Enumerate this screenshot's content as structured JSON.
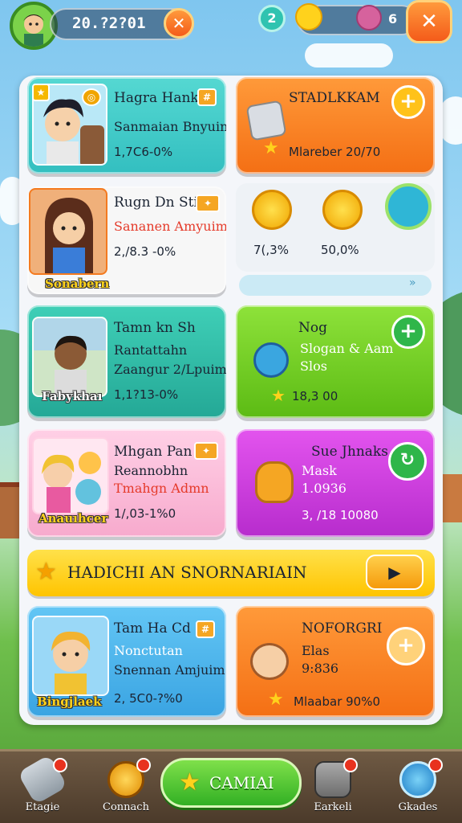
{
  "top_bar": {
    "coins": "20.?2?01",
    "gems_badge": "2",
    "counter": "6"
  },
  "cards": [
    {
      "title": "Hagra Hank",
      "subtitle": "Sanmaian Bnyuin",
      "value": "1,7C6-0%"
    },
    {
      "title": "STADLKKAM",
      "value": "Mlareber 20/70"
    },
    {
      "title": "Rugn Dn Sti",
      "subtitle": "Sananen Amyuim",
      "value": "2,/8.3 -0%",
      "tag": "Sonabern"
    },
    {
      "stat_left": "7(,3%",
      "stat_right": "50,0%"
    },
    {
      "title": "Tamn kn Sh",
      "subtitle": "Rantattahn",
      "subtitle2": "Zaangur 2/Lpuim",
      "value": "1,1?13-0%",
      "tag": "Fabykhaı"
    },
    {
      "title": "Nog",
      "subtitle": "Slogan & Aam",
      "subtitle2": "Slos",
      "value": "18,3 00"
    },
    {
      "title": "Mhgan Pan",
      "subtitle": "Reannobhn",
      "subtitle2": "Tmahgn Admn",
      "value": "1/,03-1%0",
      "tag": "Anauıhcer"
    },
    {
      "title": "Sue Jhnaks",
      "subtitle": "Mask",
      "subtitle2": "1.0936",
      "value": "3, /18 10080"
    },
    {
      "title": "Tam Ha Cd",
      "subtitle": "Nonctutan",
      "subtitle2": "Snennan Amjuim",
      "value": "2, 5C0-?%0",
      "tag": "Bingjlaek"
    },
    {
      "title": "NOFORGRI",
      "subtitle": "Elas",
      "subtitle2": "9:836",
      "value": "Mlaabar 90%0"
    }
  ],
  "banner": {
    "label": "HADICHI AN SNORNARIAIN"
  },
  "nav": {
    "items": [
      {
        "label": "Etagie"
      },
      {
        "label": "Connach"
      },
      {
        "label": "CAMIAI"
      },
      {
        "label": "Earkeli"
      },
      {
        "label": "Gkades"
      }
    ]
  },
  "colors": {
    "orange": "#f47a1f",
    "teal": "#3cc9c2",
    "green": "#7ed321",
    "pink": "#f9b8d8",
    "purple": "#c93fd8",
    "blue": "#4db7f0",
    "yellow": "#ffd21c"
  }
}
